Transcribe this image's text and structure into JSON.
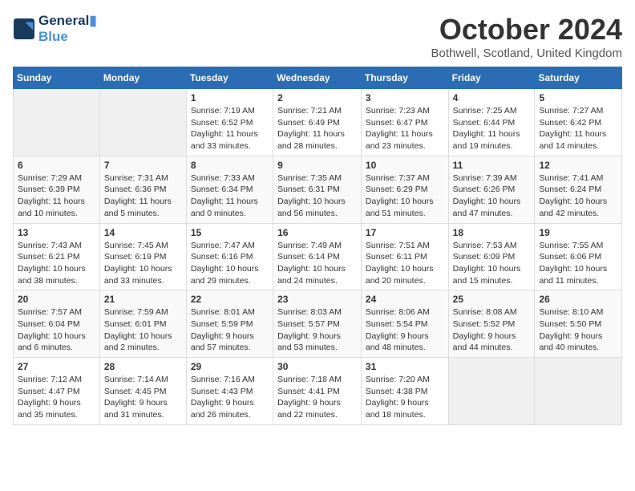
{
  "logo": {
    "line1": "General",
    "line2": "Blue"
  },
  "title": "October 2024",
  "location": "Bothwell, Scotland, United Kingdom",
  "days_of_week": [
    "Sunday",
    "Monday",
    "Tuesday",
    "Wednesday",
    "Thursday",
    "Friday",
    "Saturday"
  ],
  "weeks": [
    [
      {
        "day": "",
        "sunrise": "",
        "sunset": "",
        "daylight": "",
        "empty": true
      },
      {
        "day": "",
        "sunrise": "",
        "sunset": "",
        "daylight": "",
        "empty": true
      },
      {
        "day": "1",
        "sunrise": "Sunrise: 7:19 AM",
        "sunset": "Sunset: 6:52 PM",
        "daylight": "Daylight: 11 hours and 33 minutes."
      },
      {
        "day": "2",
        "sunrise": "Sunrise: 7:21 AM",
        "sunset": "Sunset: 6:49 PM",
        "daylight": "Daylight: 11 hours and 28 minutes."
      },
      {
        "day": "3",
        "sunrise": "Sunrise: 7:23 AM",
        "sunset": "Sunset: 6:47 PM",
        "daylight": "Daylight: 11 hours and 23 minutes."
      },
      {
        "day": "4",
        "sunrise": "Sunrise: 7:25 AM",
        "sunset": "Sunset: 6:44 PM",
        "daylight": "Daylight: 11 hours and 19 minutes."
      },
      {
        "day": "5",
        "sunrise": "Sunrise: 7:27 AM",
        "sunset": "Sunset: 6:42 PM",
        "daylight": "Daylight: 11 hours and 14 minutes."
      }
    ],
    [
      {
        "day": "6",
        "sunrise": "Sunrise: 7:29 AM",
        "sunset": "Sunset: 6:39 PM",
        "daylight": "Daylight: 11 hours and 10 minutes."
      },
      {
        "day": "7",
        "sunrise": "Sunrise: 7:31 AM",
        "sunset": "Sunset: 6:36 PM",
        "daylight": "Daylight: 11 hours and 5 minutes."
      },
      {
        "day": "8",
        "sunrise": "Sunrise: 7:33 AM",
        "sunset": "Sunset: 6:34 PM",
        "daylight": "Daylight: 11 hours and 0 minutes."
      },
      {
        "day": "9",
        "sunrise": "Sunrise: 7:35 AM",
        "sunset": "Sunset: 6:31 PM",
        "daylight": "Daylight: 10 hours and 56 minutes."
      },
      {
        "day": "10",
        "sunrise": "Sunrise: 7:37 AM",
        "sunset": "Sunset: 6:29 PM",
        "daylight": "Daylight: 10 hours and 51 minutes."
      },
      {
        "day": "11",
        "sunrise": "Sunrise: 7:39 AM",
        "sunset": "Sunset: 6:26 PM",
        "daylight": "Daylight: 10 hours and 47 minutes."
      },
      {
        "day": "12",
        "sunrise": "Sunrise: 7:41 AM",
        "sunset": "Sunset: 6:24 PM",
        "daylight": "Daylight: 10 hours and 42 minutes."
      }
    ],
    [
      {
        "day": "13",
        "sunrise": "Sunrise: 7:43 AM",
        "sunset": "Sunset: 6:21 PM",
        "daylight": "Daylight: 10 hours and 38 minutes."
      },
      {
        "day": "14",
        "sunrise": "Sunrise: 7:45 AM",
        "sunset": "Sunset: 6:19 PM",
        "daylight": "Daylight: 10 hours and 33 minutes."
      },
      {
        "day": "15",
        "sunrise": "Sunrise: 7:47 AM",
        "sunset": "Sunset: 6:16 PM",
        "daylight": "Daylight: 10 hours and 29 minutes."
      },
      {
        "day": "16",
        "sunrise": "Sunrise: 7:49 AM",
        "sunset": "Sunset: 6:14 PM",
        "daylight": "Daylight: 10 hours and 24 minutes."
      },
      {
        "day": "17",
        "sunrise": "Sunrise: 7:51 AM",
        "sunset": "Sunset: 6:11 PM",
        "daylight": "Daylight: 10 hours and 20 minutes."
      },
      {
        "day": "18",
        "sunrise": "Sunrise: 7:53 AM",
        "sunset": "Sunset: 6:09 PM",
        "daylight": "Daylight: 10 hours and 15 minutes."
      },
      {
        "day": "19",
        "sunrise": "Sunrise: 7:55 AM",
        "sunset": "Sunset: 6:06 PM",
        "daylight": "Daylight: 10 hours and 11 minutes."
      }
    ],
    [
      {
        "day": "20",
        "sunrise": "Sunrise: 7:57 AM",
        "sunset": "Sunset: 6:04 PM",
        "daylight": "Daylight: 10 hours and 6 minutes."
      },
      {
        "day": "21",
        "sunrise": "Sunrise: 7:59 AM",
        "sunset": "Sunset: 6:01 PM",
        "daylight": "Daylight: 10 hours and 2 minutes."
      },
      {
        "day": "22",
        "sunrise": "Sunrise: 8:01 AM",
        "sunset": "Sunset: 5:59 PM",
        "daylight": "Daylight: 9 hours and 57 minutes."
      },
      {
        "day": "23",
        "sunrise": "Sunrise: 8:03 AM",
        "sunset": "Sunset: 5:57 PM",
        "daylight": "Daylight: 9 hours and 53 minutes."
      },
      {
        "day": "24",
        "sunrise": "Sunrise: 8:06 AM",
        "sunset": "Sunset: 5:54 PM",
        "daylight": "Daylight: 9 hours and 48 minutes."
      },
      {
        "day": "25",
        "sunrise": "Sunrise: 8:08 AM",
        "sunset": "Sunset: 5:52 PM",
        "daylight": "Daylight: 9 hours and 44 minutes."
      },
      {
        "day": "26",
        "sunrise": "Sunrise: 8:10 AM",
        "sunset": "Sunset: 5:50 PM",
        "daylight": "Daylight: 9 hours and 40 minutes."
      }
    ],
    [
      {
        "day": "27",
        "sunrise": "Sunrise: 7:12 AM",
        "sunset": "Sunset: 4:47 PM",
        "daylight": "Daylight: 9 hours and 35 minutes."
      },
      {
        "day": "28",
        "sunrise": "Sunrise: 7:14 AM",
        "sunset": "Sunset: 4:45 PM",
        "daylight": "Daylight: 9 hours and 31 minutes."
      },
      {
        "day": "29",
        "sunrise": "Sunrise: 7:16 AM",
        "sunset": "Sunset: 4:43 PM",
        "daylight": "Daylight: 9 hours and 26 minutes."
      },
      {
        "day": "30",
        "sunrise": "Sunrise: 7:18 AM",
        "sunset": "Sunset: 4:41 PM",
        "daylight": "Daylight: 9 hours and 22 minutes."
      },
      {
        "day": "31",
        "sunrise": "Sunrise: 7:20 AM",
        "sunset": "Sunset: 4:38 PM",
        "daylight": "Daylight: 9 hours and 18 minutes."
      },
      {
        "day": "",
        "sunrise": "",
        "sunset": "",
        "daylight": "",
        "empty": true
      },
      {
        "day": "",
        "sunrise": "",
        "sunset": "",
        "daylight": "",
        "empty": true
      }
    ]
  ],
  "colors": {
    "header_bg": "#2a6db5",
    "header_text": "#ffffff",
    "empty_cell": "#f0f0f0",
    "title_color": "#333333"
  }
}
